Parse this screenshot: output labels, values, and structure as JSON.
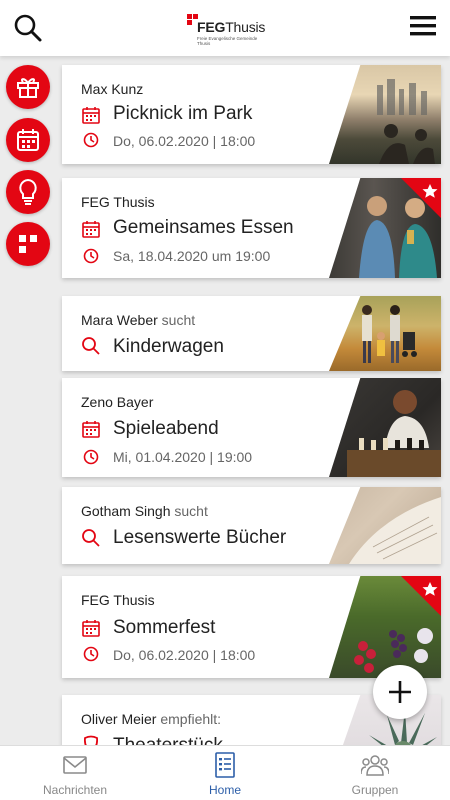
{
  "header": {
    "logo": {
      "name_bold": "FEG",
      "name_light": "Thusis",
      "tagline": "Freie Evangelische Gemeinde Thusis"
    }
  },
  "sidebar": {
    "buttons": [
      {
        "icon": "gift-icon"
      },
      {
        "icon": "calendar-icon"
      },
      {
        "icon": "lightbulb-icon"
      },
      {
        "icon": "groups-dots-icon"
      }
    ]
  },
  "feed": [
    {
      "type": "event",
      "author": "Max Kunz",
      "verb": "",
      "title": "Picknick im Park",
      "date": "Do, 06.02.2020 | 18:00",
      "starred": false
    },
    {
      "type": "event",
      "author": "FEG Thusis",
      "verb": "",
      "title": "Gemeinsames Essen",
      "date": "Sa, 18.04.2020 um 19:00",
      "starred": true
    },
    {
      "type": "search",
      "author": "Mara Weber",
      "verb": "sucht",
      "title": "Kinderwagen",
      "starred": false
    },
    {
      "type": "event",
      "author": "Zeno Bayer",
      "verb": "",
      "title": "Spieleabend",
      "date": "Mi, 01.04.2020 | 19:00",
      "starred": false
    },
    {
      "type": "search",
      "author": "Gotham Singh",
      "verb": "sucht",
      "title": "Lesenswerte Bücher",
      "starred": false
    },
    {
      "type": "event",
      "author": "FEG Thusis",
      "verb": "",
      "title": "Sommerfest",
      "date": "Do, 06.02.2020 | 18:00",
      "starred": true
    },
    {
      "type": "recommend",
      "author": "Oliver Meier",
      "verb": "empfiehlt:",
      "title": "Theaterstück",
      "starred": false
    }
  ],
  "nav": {
    "items": [
      {
        "label": "Nachrichten",
        "icon": "envelope-icon",
        "active": false
      },
      {
        "label": "Home",
        "icon": "list-icon",
        "active": true
      },
      {
        "label": "Gruppen",
        "icon": "people-icon",
        "active": false
      }
    ]
  },
  "colors": {
    "accent": "#e30613",
    "nav_active": "#2c5ea8",
    "background": "#ececec"
  }
}
